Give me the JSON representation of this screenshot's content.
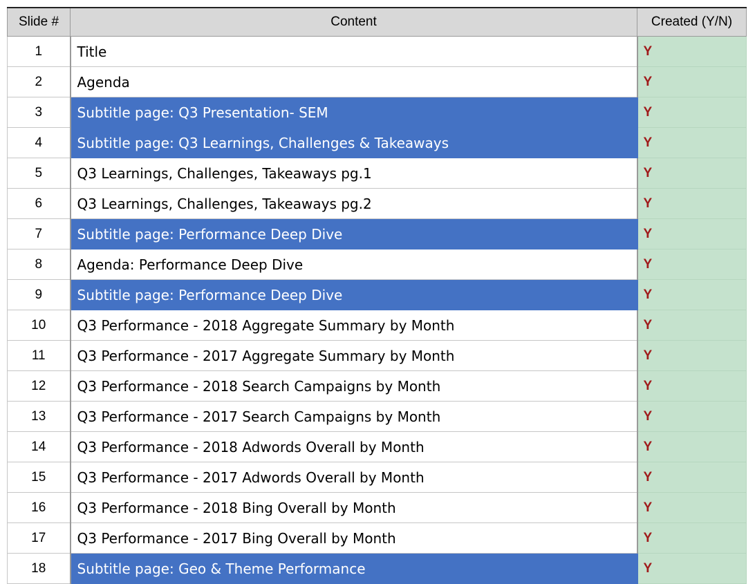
{
  "header": {
    "slide_num": "Slide #",
    "content": "Content",
    "created": "Created (Y/N)"
  },
  "rows": [
    {
      "num": "1",
      "content": "Title",
      "created": "Y",
      "subtitle": false
    },
    {
      "num": "2",
      "content": "Agenda",
      "created": "Y",
      "subtitle": false
    },
    {
      "num": "3",
      "content": "Subtitle page: Q3 Presentation- SEM",
      "created": "Y",
      "subtitle": true
    },
    {
      "num": "4",
      "content": "Subtitle page: Q3 Learnings, Challenges & Takeaways",
      "created": "Y",
      "subtitle": true
    },
    {
      "num": "5",
      "content": "Q3 Learnings, Challenges, Takeaways pg.1",
      "created": "Y",
      "subtitle": false
    },
    {
      "num": "6",
      "content": "Q3 Learnings, Challenges, Takeaways pg.2",
      "created": "Y",
      "subtitle": false
    },
    {
      "num": "7",
      "content": "Subtitle page: Performance Deep Dive",
      "created": "Y",
      "subtitle": true
    },
    {
      "num": "8",
      "content": "Agenda: Performance Deep Dive",
      "created": "Y",
      "subtitle": false
    },
    {
      "num": "9",
      "content": "Subtitle page: Performance Deep Dive",
      "created": "Y",
      "subtitle": true
    },
    {
      "num": "10",
      "content": "Q3 Performance - 2018 Aggregate Summary by Month",
      "created": "Y",
      "subtitle": false
    },
    {
      "num": "11",
      "content": "Q3 Performance - 2017 Aggregate Summary by Month",
      "created": "Y",
      "subtitle": false
    },
    {
      "num": "12",
      "content": "Q3 Performance - 2018 Search Campaigns by Month",
      "created": "Y",
      "subtitle": false
    },
    {
      "num": "13",
      "content": "Q3 Performance - 2017 Search Campaigns by Month",
      "created": "Y",
      "subtitle": false
    },
    {
      "num": "14",
      "content": "Q3 Performance - 2018 Adwords Overall by Month",
      "created": "Y",
      "subtitle": false
    },
    {
      "num": "15",
      "content": "Q3 Performance - 2017 Adwords Overall by Month",
      "created": "Y",
      "subtitle": false
    },
    {
      "num": "16",
      "content": "Q3 Performance - 2018 Bing Overall by Month",
      "created": "Y",
      "subtitle": false
    },
    {
      "num": "17",
      "content": "Q3 Performance - 2017 Bing Overall by Month",
      "created": "Y",
      "subtitle": false
    },
    {
      "num": "18",
      "content": "Subtitle page: Geo & Theme Performance",
      "created": "Y",
      "subtitle": true
    }
  ],
  "colors": {
    "subtitle_fill": "#4472c4",
    "created_fill": "#c5e2cd",
    "created_text": "#a01b1b",
    "header_fill": "#d8d8d8"
  }
}
